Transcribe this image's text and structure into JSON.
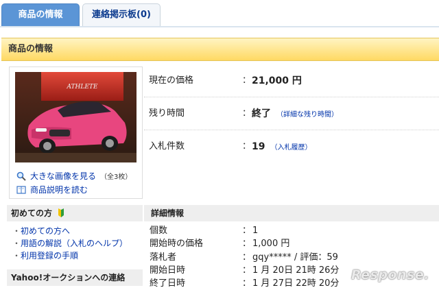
{
  "tabs": [
    {
      "label": "商品の情報",
      "active": true
    },
    {
      "label": "連絡掲示板(0)",
      "active": false
    }
  ],
  "section_title": "商品の情報",
  "photo": {
    "large_image_link": "大きな画像を見る",
    "image_count": "（全3枚）",
    "description_link": "商品説明を読む",
    "box_brand_text": "ATHLETE"
  },
  "info": {
    "price_label": "現在の価格",
    "price_value": "21,000 円",
    "time_label": "残り時間",
    "time_value": "終了",
    "time_link": "（詳細な残り時間）",
    "bids_label": "入札件数",
    "bids_value": "19",
    "bids_link": "（入札履歴）"
  },
  "sidebar": {
    "beginner_title": "初めての方",
    "items": [
      {
        "label": "初めての方へ"
      },
      {
        "label": "用語の解説（入札のヘルプ）"
      },
      {
        "label": "利用登録の手順"
      }
    ],
    "contact_title": "Yahoo!オークションへの連絡"
  },
  "details": {
    "title": "詳細情報",
    "rows": [
      {
        "label": "個数",
        "value": "1"
      },
      {
        "label": "開始時の価格",
        "value": "1,000 円"
      },
      {
        "label": "落札者",
        "value": "gqy***** / 評価：59"
      },
      {
        "label": "開始日時",
        "value": "1 月 20日 21時 26分"
      },
      {
        "label": "終了日時",
        "value": "1 月 27日 22時 20分"
      }
    ]
  },
  "watermark": "Response.",
  "colors": {
    "tab_active": "#5b95d6",
    "tab_inactive_text": "#0b3a8e",
    "section_header": "#ffd963",
    "link": "#0033aa",
    "car": "#e8467f"
  }
}
